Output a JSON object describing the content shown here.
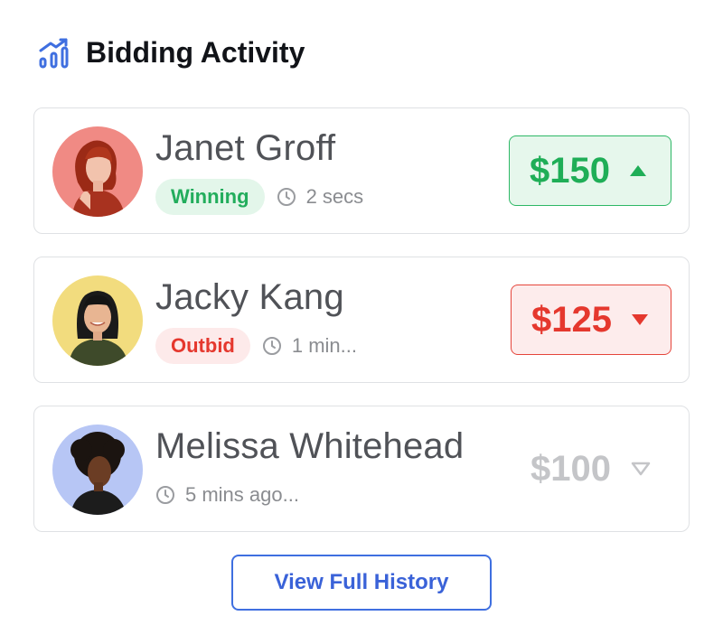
{
  "header": {
    "title": "Bidding Activity",
    "icon": "bar-chart-icon",
    "accent": "#3f6fe0"
  },
  "bids": [
    {
      "name": "Janet Groff",
      "status": "Winning",
      "time": "2 secs",
      "amount": "$150",
      "trend": "up",
      "avatar_bg": "#f08a84"
    },
    {
      "name": "Jacky Kang",
      "status": "Outbid",
      "time": "1 min...",
      "amount": "$125",
      "trend": "down",
      "avatar_bg": "#f2dc7e"
    },
    {
      "name": "Melissa Whitehead",
      "status": "",
      "time": "5 mins ago...",
      "amount": "$100",
      "trend": "neutral",
      "avatar_bg": "#b7c6f5"
    }
  ],
  "colors": {
    "winning": "#22ad5c",
    "outbid": "#e5382e",
    "neutral": "#c4c5c8"
  },
  "actions": {
    "view_history": "View Full History"
  }
}
